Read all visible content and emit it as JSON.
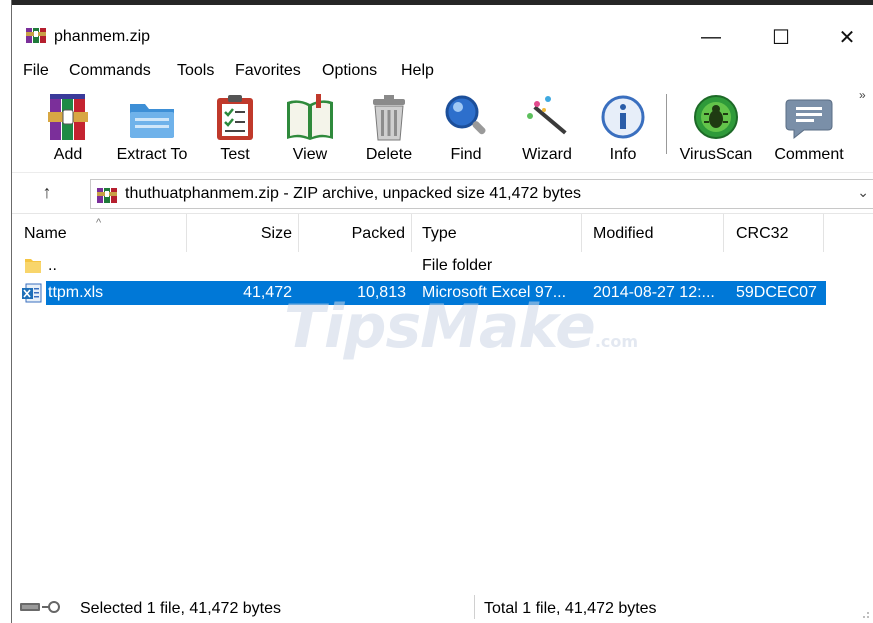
{
  "window": {
    "title": "phanmem.zip",
    "controls": {
      "minimize": "—",
      "maximize": "☐",
      "close": "✕"
    }
  },
  "menu": [
    "File",
    "Commands",
    "Tools",
    "Favorites",
    "Options",
    "Help"
  ],
  "toolbar": {
    "tools": [
      {
        "label": "Add",
        "icon": "add-archive-icon"
      },
      {
        "label": "Extract To",
        "icon": "extract-folder-icon"
      },
      {
        "label": "Test",
        "icon": "test-clipboard-icon"
      },
      {
        "label": "View",
        "icon": "view-book-icon"
      },
      {
        "label": "Delete",
        "icon": "trash-icon"
      },
      {
        "label": "Find",
        "icon": "magnifier-icon"
      },
      {
        "label": "Wizard",
        "icon": "wizard-wand-icon"
      },
      {
        "label": "Info",
        "icon": "info-icon"
      },
      {
        "label": "VirusScan",
        "icon": "virus-scan-icon"
      },
      {
        "label": "Comment",
        "icon": "comment-icon"
      }
    ],
    "overflow": "»"
  },
  "address": {
    "up_arrow": "↑",
    "path": "thuthuatphanmem.zip - ZIP archive, unpacked size 41,472 bytes",
    "dropdown": "⌄"
  },
  "columns": {
    "name": "Name",
    "size": "Size",
    "packed": "Packed",
    "type": "Type",
    "modified": "Modified",
    "crc": "CRC32",
    "sort_indicator": "^"
  },
  "rows": [
    {
      "name": "..",
      "size": "",
      "packed": "",
      "type": "File folder",
      "modified": "",
      "crc": "",
      "icon": "folder-icon",
      "selected": false
    },
    {
      "name": "ttpm.xls",
      "size": "41,472",
      "packed": "10,813",
      "type": "Microsoft Excel 97...",
      "modified": "2014-08-27 12:...",
      "crc": "59DCEC07",
      "icon": "excel-file-icon",
      "selected": true
    }
  ],
  "watermark": {
    "main": "TipsMake",
    "suffix": ".com"
  },
  "status": {
    "left": "Selected 1 file, 41,472 bytes",
    "right": "Total 1 file, 41,472 bytes"
  },
  "colors": {
    "selection": "#0078d7",
    "watermark": "#cdd7e6"
  }
}
